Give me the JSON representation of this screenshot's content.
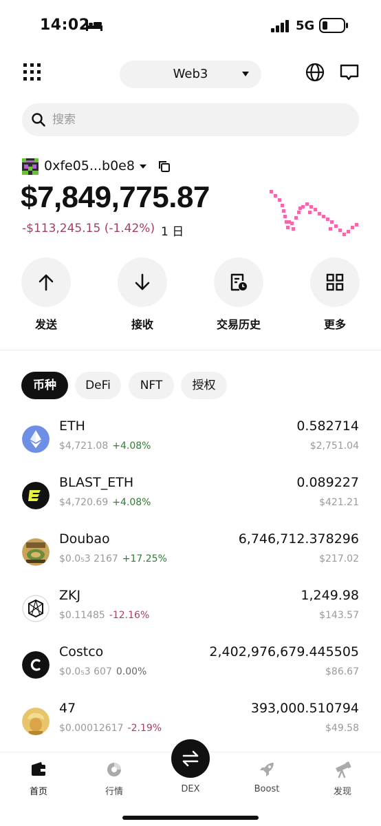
{
  "status": {
    "time": "14:02",
    "network": "5G"
  },
  "header": {
    "network_label": "Web3"
  },
  "search": {
    "placeholder": "搜索"
  },
  "wallet": {
    "address": "0xfe05...b0e8",
    "balance": "$7,849,775.87",
    "pnl": "-$113,245.15 (-1.42%)",
    "period": "1 日"
  },
  "actions": {
    "send": "发送",
    "receive": "接收",
    "history": "交易历史",
    "more": "更多"
  },
  "tabs": [
    "币种",
    "DeFi",
    "NFT",
    "授权"
  ],
  "tokens": [
    {
      "name": "ETH",
      "price": "$4,721.08",
      "change": "+4.08%",
      "amount": "0.582714",
      "value": "$2,751.04"
    },
    {
      "name": "BLAST_ETH",
      "price": "$4,720.69",
      "change": "+4.08%",
      "amount": "0.089227",
      "value": "$421.21"
    },
    {
      "name": "Doubao",
      "price": "$0.0₅3 2167",
      "change": "+17.25%",
      "amount": "6,746,712.378296",
      "value": "$217.02"
    },
    {
      "name": "ZKJ",
      "price": "$0.11485",
      "change": "-12.16%",
      "amount": "1,249.98",
      "value": "$143.57"
    },
    {
      "name": "Costco",
      "price": "$0.0₅3 607",
      "change": "0.00%",
      "amount": "2,402,976,679.445505",
      "value": "$86.67"
    },
    {
      "name": "47",
      "price": "$0.00012617",
      "change": "-2.19%",
      "amount": "393,000.510794",
      "value": "$49.58"
    }
  ],
  "nav": {
    "home": "首页",
    "market": "行情",
    "dex": "DEX",
    "boost": "Boost",
    "discover": "发现"
  },
  "colors": {
    "accent_negative": "#a6405f",
    "accent_positive": "#2e7d32",
    "spark": "#f06aa8"
  }
}
